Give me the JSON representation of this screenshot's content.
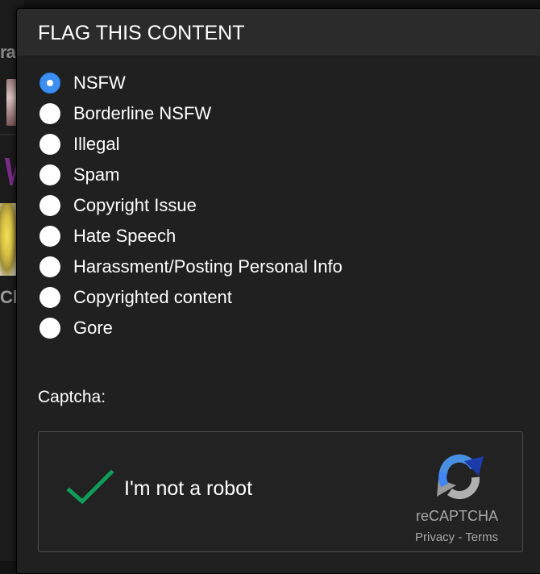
{
  "background": {
    "partial_text_top": "raç",
    "partial_text_bottom": "Cl"
  },
  "modal": {
    "title": "FLAG THIS CONTENT",
    "options": [
      {
        "label": "NSFW",
        "checked": true
      },
      {
        "label": "Borderline NSFW",
        "checked": false
      },
      {
        "label": "Illegal",
        "checked": false
      },
      {
        "label": "Spam",
        "checked": false
      },
      {
        "label": "Copyright Issue",
        "checked": false
      },
      {
        "label": "Hate Speech",
        "checked": false
      },
      {
        "label": "Harassment/Posting Personal Info",
        "checked": false
      },
      {
        "label": "Copyrighted content",
        "checked": false
      },
      {
        "label": "Gore",
        "checked": false
      }
    ],
    "captcha_label": "Captcha:"
  },
  "recaptcha": {
    "checkbox_label": "I'm not a robot",
    "checked": true,
    "brand": "reCAPTCHA",
    "privacy": "Privacy",
    "separator": " - ",
    "terms": "Terms",
    "check_color": "#0f9d58",
    "icon": "recaptcha-logo-icon"
  },
  "colors": {
    "accent": "#3b8ff3",
    "modal_bg": "#202020",
    "header_bg": "#2b2b2b",
    "text": "#ffffff"
  }
}
